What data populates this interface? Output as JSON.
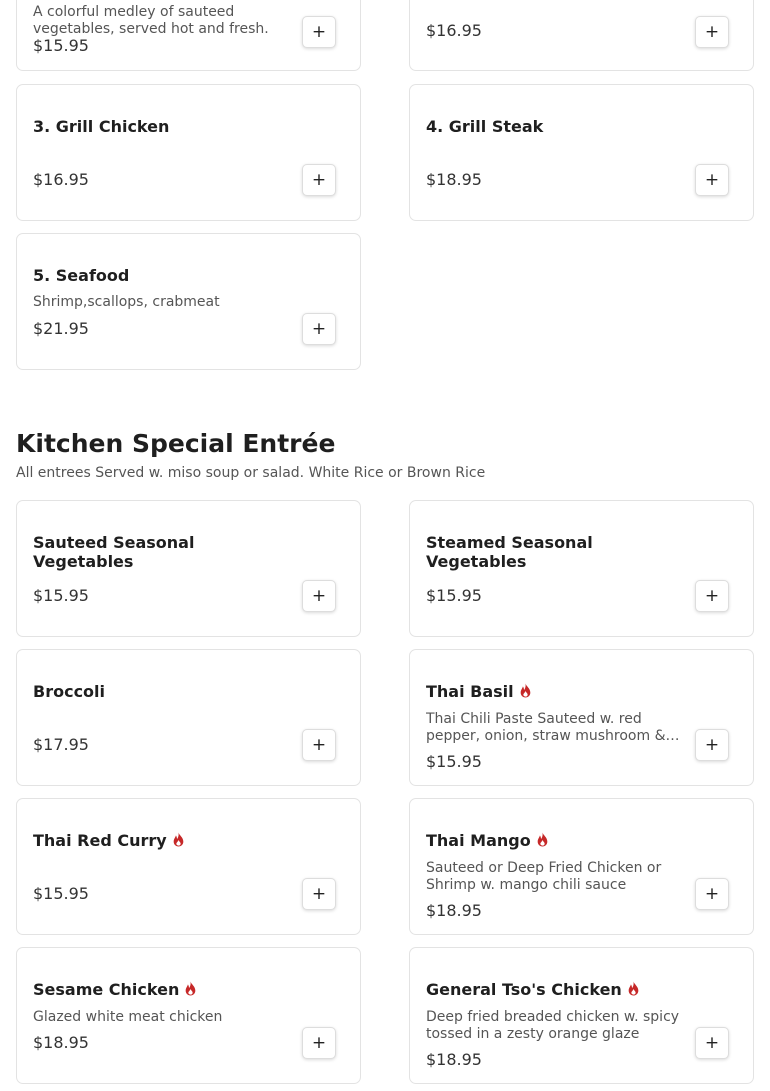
{
  "colors": {
    "spicy": "#c62828",
    "card_border": "#e3e3e3",
    "price_text": "#333333"
  },
  "top_items": {
    "item_2": {
      "desc": "A colorful medley of sauteed vegetables, served hot and fresh.",
      "price": "$15.95"
    },
    "item_2b": {
      "price": "$16.95"
    },
    "item_3": {
      "name": "3. Grill Chicken",
      "price": "$16.95"
    },
    "item_4": {
      "name": "4. Grill Steak",
      "price": "$18.95"
    },
    "item_5": {
      "name": "5. Seafood",
      "desc": "Shrimp,scallops, crabmeat",
      "price": "$21.95"
    }
  },
  "kitchen_special": {
    "title": "Kitchen Special Entrée",
    "subtitle": "All entrees Served w. miso soup or salad. White Rice or Brown Rice",
    "items": [
      {
        "name": "Sauteed Seasonal Vegetables",
        "price": "$15.95"
      },
      {
        "name": "Steamed Seasonal Vegetables",
        "price": "$15.95"
      },
      {
        "name": "Broccoli",
        "price": "$17.95"
      },
      {
        "name": "Thai Basil",
        "desc": "Thai Chili Paste Sauteed w. red pepper, onion, straw mushroom & basil",
        "price": "$15.95",
        "spicy_icon": "flame-icon"
      },
      {
        "name": "Thai Red Curry",
        "price": "$15.95",
        "spicy_icon": "flame-icon"
      },
      {
        "name": "Thai Mango",
        "desc": "Sauteed or Deep Fried Chicken or Shrimp w. mango chili sauce",
        "price": "$18.95",
        "spicy_icon": "flame-icon"
      },
      {
        "name": "Sesame Chicken",
        "desc": "Glazed white meat chicken",
        "price": "$18.95",
        "spicy_icon": "flame-icon"
      },
      {
        "name": "General Tso's Chicken",
        "desc": "Deep fried breaded chicken w. spicy tossed in a zesty orange glaze",
        "price": "$18.95",
        "spicy_icon": "flame-icon"
      }
    ]
  },
  "add_button": {
    "icon": "plus-icon",
    "label": "+"
  }
}
